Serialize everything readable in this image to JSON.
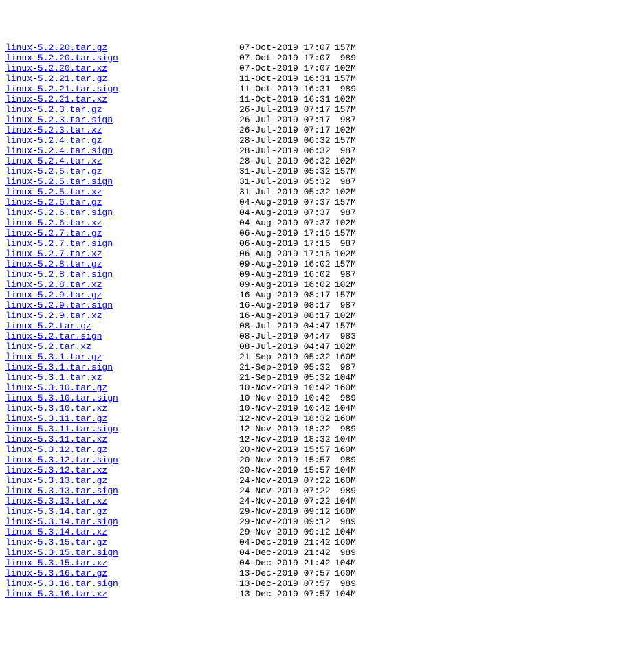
{
  "files": [
    {
      "name": "linux-5.2.20.tar.gz",
      "date": "07-Oct-2019 17:07",
      "size": "157M"
    },
    {
      "name": "linux-5.2.20.tar.sign",
      "date": "07-Oct-2019 17:07",
      "size": "989"
    },
    {
      "name": "linux-5.2.20.tar.xz",
      "date": "07-Oct-2019 17:07",
      "size": "102M"
    },
    {
      "name": "linux-5.2.21.tar.gz",
      "date": "11-Oct-2019 16:31",
      "size": "157M"
    },
    {
      "name": "linux-5.2.21.tar.sign",
      "date": "11-Oct-2019 16:31",
      "size": "989"
    },
    {
      "name": "linux-5.2.21.tar.xz",
      "date": "11-Oct-2019 16:31",
      "size": "102M"
    },
    {
      "name": "linux-5.2.3.tar.gz",
      "date": "26-Jul-2019 07:17",
      "size": "157M"
    },
    {
      "name": "linux-5.2.3.tar.sign",
      "date": "26-Jul-2019 07:17",
      "size": "987"
    },
    {
      "name": "linux-5.2.3.tar.xz",
      "date": "26-Jul-2019 07:17",
      "size": "102M"
    },
    {
      "name": "linux-5.2.4.tar.gz",
      "date": "28-Jul-2019 06:32",
      "size": "157M"
    },
    {
      "name": "linux-5.2.4.tar.sign",
      "date": "28-Jul-2019 06:32",
      "size": "987"
    },
    {
      "name": "linux-5.2.4.tar.xz",
      "date": "28-Jul-2019 06:32",
      "size": "102M"
    },
    {
      "name": "linux-5.2.5.tar.gz",
      "date": "31-Jul-2019 05:32",
      "size": "157M"
    },
    {
      "name": "linux-5.2.5.tar.sign",
      "date": "31-Jul-2019 05:32",
      "size": "987"
    },
    {
      "name": "linux-5.2.5.tar.xz",
      "date": "31-Jul-2019 05:32",
      "size": "102M"
    },
    {
      "name": "linux-5.2.6.tar.gz",
      "date": "04-Aug-2019 07:37",
      "size": "157M"
    },
    {
      "name": "linux-5.2.6.tar.sign",
      "date": "04-Aug-2019 07:37",
      "size": "987"
    },
    {
      "name": "linux-5.2.6.tar.xz",
      "date": "04-Aug-2019 07:37",
      "size": "102M"
    },
    {
      "name": "linux-5.2.7.tar.gz",
      "date": "06-Aug-2019 17:16",
      "size": "157M"
    },
    {
      "name": "linux-5.2.7.tar.sign",
      "date": "06-Aug-2019 17:16",
      "size": "987"
    },
    {
      "name": "linux-5.2.7.tar.xz",
      "date": "06-Aug-2019 17:16",
      "size": "102M"
    },
    {
      "name": "linux-5.2.8.tar.gz",
      "date": "09-Aug-2019 16:02",
      "size": "157M"
    },
    {
      "name": "linux-5.2.8.tar.sign",
      "date": "09-Aug-2019 16:02",
      "size": "987"
    },
    {
      "name": "linux-5.2.8.tar.xz",
      "date": "09-Aug-2019 16:02",
      "size": "102M"
    },
    {
      "name": "linux-5.2.9.tar.gz",
      "date": "16-Aug-2019 08:17",
      "size": "157M"
    },
    {
      "name": "linux-5.2.9.tar.sign",
      "date": "16-Aug-2019 08:17",
      "size": "987"
    },
    {
      "name": "linux-5.2.9.tar.xz",
      "date": "16-Aug-2019 08:17",
      "size": "102M"
    },
    {
      "name": "linux-5.2.tar.gz",
      "date": "08-Jul-2019 04:47",
      "size": "157M"
    },
    {
      "name": "linux-5.2.tar.sign",
      "date": "08-Jul-2019 04:47",
      "size": "983"
    },
    {
      "name": "linux-5.2.tar.xz",
      "date": "08-Jul-2019 04:47",
      "size": "102M"
    },
    {
      "name": "linux-5.3.1.tar.gz",
      "date": "21-Sep-2019 05:32",
      "size": "160M"
    },
    {
      "name": "linux-5.3.1.tar.sign",
      "date": "21-Sep-2019 05:32",
      "size": "987"
    },
    {
      "name": "linux-5.3.1.tar.xz",
      "date": "21-Sep-2019 05:32",
      "size": "104M"
    },
    {
      "name": "linux-5.3.10.tar.gz",
      "date": "10-Nov-2019 10:42",
      "size": "160M"
    },
    {
      "name": "linux-5.3.10.tar.sign",
      "date": "10-Nov-2019 10:42",
      "size": "989"
    },
    {
      "name": "linux-5.3.10.tar.xz",
      "date": "10-Nov-2019 10:42",
      "size": "104M"
    },
    {
      "name": "linux-5.3.11.tar.gz",
      "date": "12-Nov-2019 18:32",
      "size": "160M"
    },
    {
      "name": "linux-5.3.11.tar.sign",
      "date": "12-Nov-2019 18:32",
      "size": "989"
    },
    {
      "name": "linux-5.3.11.tar.xz",
      "date": "12-Nov-2019 18:32",
      "size": "104M"
    },
    {
      "name": "linux-5.3.12.tar.gz",
      "date": "20-Nov-2019 15:57",
      "size": "160M"
    },
    {
      "name": "linux-5.3.12.tar.sign",
      "date": "20-Nov-2019 15:57",
      "size": "989"
    },
    {
      "name": "linux-5.3.12.tar.xz",
      "date": "20-Nov-2019 15:57",
      "size": "104M"
    },
    {
      "name": "linux-5.3.13.tar.gz",
      "date": "24-Nov-2019 07:22",
      "size": "160M"
    },
    {
      "name": "linux-5.3.13.tar.sign",
      "date": "24-Nov-2019 07:22",
      "size": "989"
    },
    {
      "name": "linux-5.3.13.tar.xz",
      "date": "24-Nov-2019 07:22",
      "size": "104M"
    },
    {
      "name": "linux-5.3.14.tar.gz",
      "date": "29-Nov-2019 09:12",
      "size": "160M"
    },
    {
      "name": "linux-5.3.14.tar.sign",
      "date": "29-Nov-2019 09:12",
      "size": "989"
    },
    {
      "name": "linux-5.3.14.tar.xz",
      "date": "29-Nov-2019 09:12",
      "size": "104M"
    },
    {
      "name": "linux-5.3.15.tar.gz",
      "date": "04-Dec-2019 21:42",
      "size": "160M"
    },
    {
      "name": "linux-5.3.15.tar.sign",
      "date": "04-Dec-2019 21:42",
      "size": "989"
    },
    {
      "name": "linux-5.3.15.tar.xz",
      "date": "04-Dec-2019 21:42",
      "size": "104M"
    },
    {
      "name": "linux-5.3.16.tar.gz",
      "date": "13-Dec-2019 07:57",
      "size": "160M"
    },
    {
      "name": "linux-5.3.16.tar.sign",
      "date": "13-Dec-2019 07:57",
      "size": "989"
    },
    {
      "name": "linux-5.3.16.tar.xz",
      "date": "13-Dec-2019 07:57",
      "size": "104M"
    }
  ]
}
